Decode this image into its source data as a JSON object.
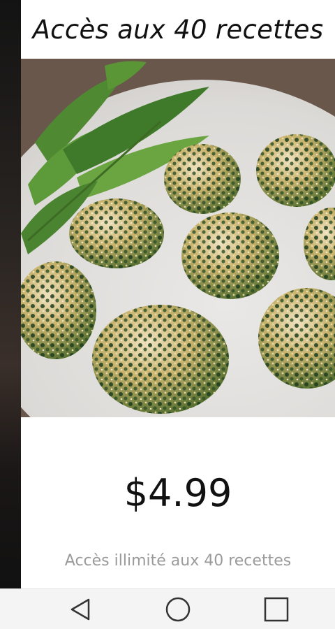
{
  "offer": {
    "title": "Accès aux 40 recettes",
    "price": "$4.99",
    "description": "Accès illimité aux 40 recettes"
  },
  "photo": {
    "subject": "spinach-cheese-bites-on-plate"
  },
  "navigation_bar": {
    "back_icon": "back-triangle-icon",
    "home_icon": "home-circle-icon",
    "recents_icon": "recents-square-icon"
  },
  "colors": {
    "title_text": "#111111",
    "price_text": "#111111",
    "description_text": "#9a9a9a",
    "navbar_bg": "#f4f4f4",
    "nav_icon": "#333333"
  }
}
